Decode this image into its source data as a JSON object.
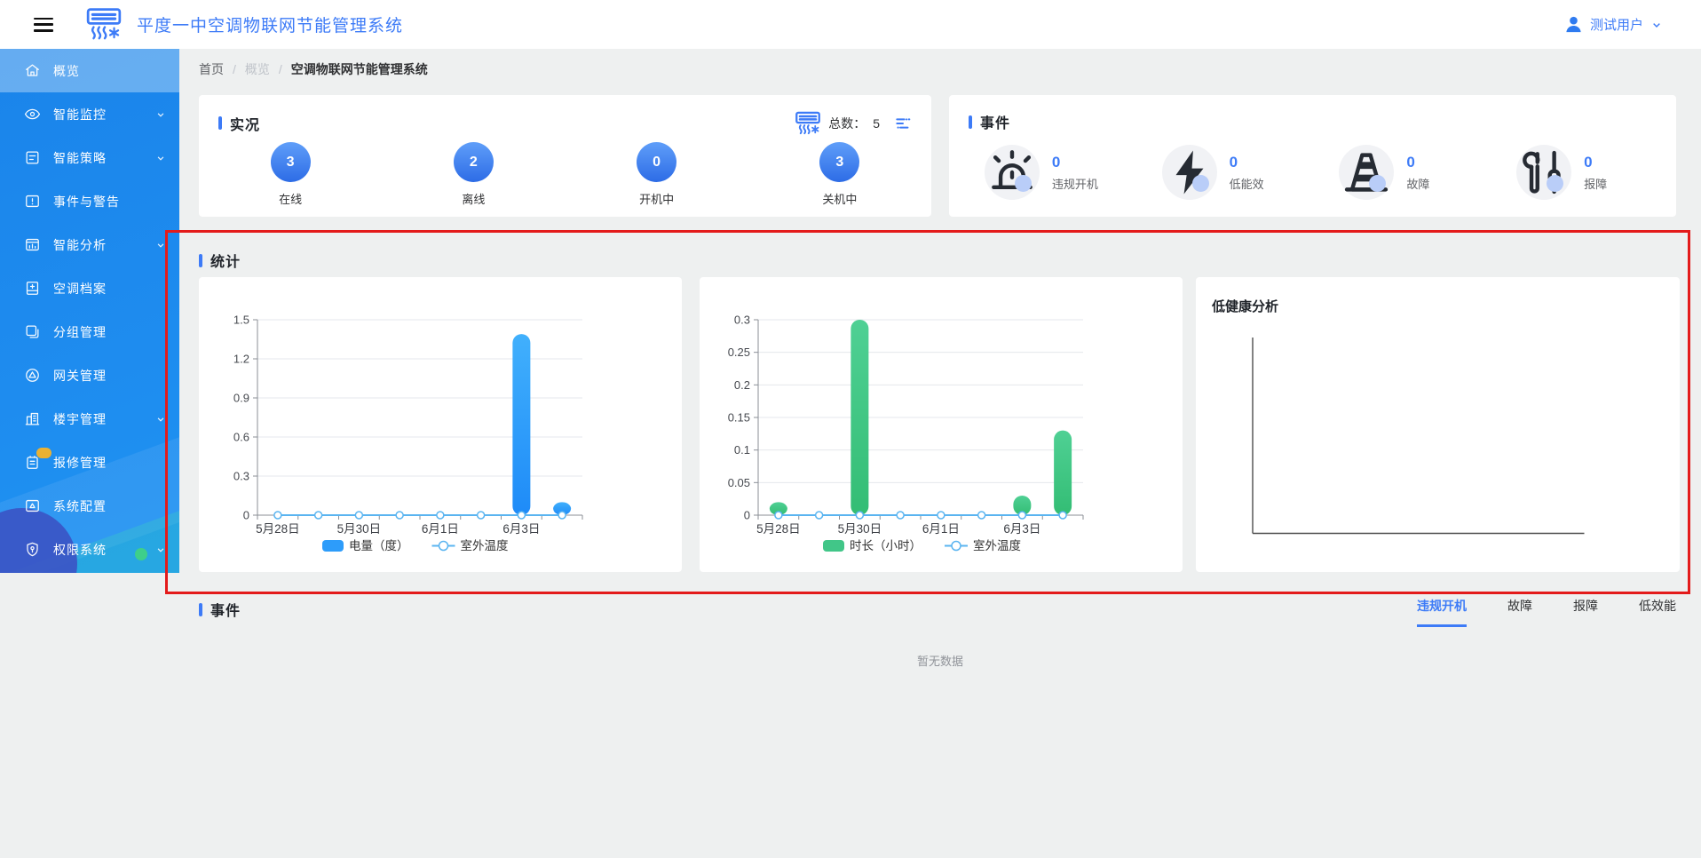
{
  "header": {
    "title": "平度一中空调物联网节能管理系统",
    "user_name": "测试用户"
  },
  "sidebar": {
    "items": [
      {
        "label": "概览",
        "icon": "home",
        "active": true,
        "chevron": false,
        "badge": false
      },
      {
        "label": "智能监控",
        "icon": "eye",
        "active": false,
        "chevron": true,
        "badge": false
      },
      {
        "label": "智能策略",
        "icon": "strategy",
        "active": false,
        "chevron": true,
        "badge": false
      },
      {
        "label": "事件与警告",
        "icon": "alert",
        "active": false,
        "chevron": false,
        "badge": false
      },
      {
        "label": "智能分析",
        "icon": "analysis",
        "active": false,
        "chevron": true,
        "badge": false
      },
      {
        "label": "空调档案",
        "icon": "archive",
        "active": false,
        "chevron": false,
        "badge": false
      },
      {
        "label": "分组管理",
        "icon": "group",
        "active": false,
        "chevron": false,
        "badge": false
      },
      {
        "label": "网关管理",
        "icon": "gateway",
        "active": false,
        "chevron": false,
        "badge": false
      },
      {
        "label": "楼宇管理",
        "icon": "building",
        "active": false,
        "chevron": true,
        "badge": false
      },
      {
        "label": "报修管理",
        "icon": "repair",
        "active": false,
        "chevron": false,
        "badge": true
      },
      {
        "label": "系统配置",
        "icon": "config",
        "active": false,
        "chevron": false,
        "badge": false
      },
      {
        "label": "权限系统",
        "icon": "permission",
        "active": false,
        "chevron": true,
        "badge": false
      }
    ]
  },
  "breadcrumb": {
    "home": "首页",
    "mid": "概览",
    "current": "空调物联网节能管理系统"
  },
  "live_panel": {
    "title": "实况",
    "total_label": "总数：",
    "total_value": "5",
    "stats": [
      {
        "value": "3",
        "label": "在线"
      },
      {
        "value": "2",
        "label": "离线"
      },
      {
        "value": "0",
        "label": "开机中"
      },
      {
        "value": "3",
        "label": "关机中"
      }
    ]
  },
  "events_panel": {
    "title": "事件",
    "items": [
      {
        "value": "0",
        "label": "违规开机",
        "icon": "siren"
      },
      {
        "value": "0",
        "label": "低能效",
        "icon": "lightning"
      },
      {
        "value": "0",
        "label": "故障",
        "icon": "cone"
      },
      {
        "value": "0",
        "label": "报障",
        "icon": "tools"
      }
    ]
  },
  "stats_section": {
    "title": "统计"
  },
  "chart_data": [
    {
      "type": "bar",
      "title": "",
      "categories": [
        "5月28日",
        "5月29日",
        "5月30日",
        "5月31日",
        "6月1日",
        "6月2日",
        "6月3日",
        "6月4日"
      ],
      "x_labels_shown": [
        "5月28日",
        "5月30日",
        "6月1日",
        "6月3日"
      ],
      "series": [
        {
          "name": "电量（度）",
          "type": "bar",
          "color_top": "#41b0fc",
          "color_bottom": "#1e8bf8",
          "color": "#2d9cfa",
          "values": [
            0,
            0,
            0,
            0,
            0,
            0,
            1.39,
            0.1
          ]
        },
        {
          "name": "室外温度",
          "type": "line",
          "color": "#5ab4f0",
          "values": [
            0,
            0,
            0,
            0,
            0,
            0,
            0,
            0
          ]
        }
      ],
      "ylim": [
        0,
        1.5
      ],
      "yticks": [
        0,
        0.3,
        0.6,
        0.9,
        1.2,
        1.5
      ],
      "grid": true,
      "legend_position": "bottom"
    },
    {
      "type": "bar",
      "title": "",
      "categories": [
        "5月28日",
        "5月29日",
        "5月30日",
        "5月31日",
        "6月1日",
        "6月2日",
        "6月3日",
        "6月4日"
      ],
      "x_labels_shown": [
        "5月28日",
        "5月30日",
        "6月1日",
        "6月3日"
      ],
      "series": [
        {
          "name": "时长（小时）",
          "type": "bar",
          "color_top": "#4fd094",
          "color_bottom": "#33bd74",
          "color": "#41c688",
          "values": [
            0.02,
            0,
            0.3,
            0,
            0,
            0,
            0.03,
            0.13
          ]
        },
        {
          "name": "室外温度",
          "type": "line",
          "color": "#5ab4f0",
          "values": [
            0,
            0,
            0,
            0,
            0,
            0,
            0,
            0
          ]
        }
      ],
      "ylim": [
        0,
        0.3
      ],
      "yticks": [
        0,
        0.05,
        0.1,
        0.15,
        0.2,
        0.25,
        0.3
      ],
      "grid": true,
      "legend_position": "bottom"
    },
    {
      "type": "line",
      "title": "低健康分析",
      "axes_only": true,
      "categories": [],
      "series": []
    }
  ],
  "bottom_events": {
    "title": "事件",
    "tabs": [
      {
        "label": "违规开机",
        "active": true
      },
      {
        "label": "故障",
        "active": false
      },
      {
        "label": "报障",
        "active": false
      },
      {
        "label": "低效能",
        "active": false
      }
    ],
    "empty_text": "暂无数据"
  },
  "colors": {
    "accent_blue": "#3d7bf7",
    "sidebar_blue": "#1b87ec",
    "bar_blue": "#2d9cfa",
    "bar_green": "#41c688",
    "line_blue": "#5ab4f0",
    "annotation_red": "#e31b1b"
  }
}
